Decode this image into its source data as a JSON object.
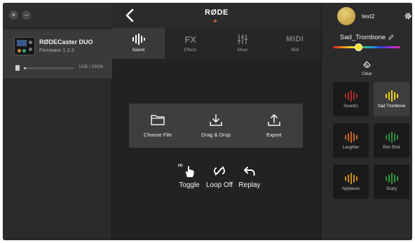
{
  "window": {
    "close_glyph": "×",
    "minimize_glyph": "–"
  },
  "device": {
    "name": "RØDECaster DUO",
    "firmware": "Firmware 1.2.2",
    "storage_text": "1GB / 29GB",
    "storage_used_fraction": 0.035
  },
  "header": {
    "logo": "RØDE"
  },
  "tabs": [
    {
      "label": "Sound",
      "icon": "sound-wave-icon",
      "active": true
    },
    {
      "label": "Effects",
      "icon_text": "FX",
      "icon": "fx-icon",
      "active": false
    },
    {
      "label": "Mixer",
      "icon": "mixer-faders-icon",
      "active": false
    },
    {
      "label": "Midi",
      "icon_text": "MIDI",
      "icon": "midi-icon",
      "active": false
    }
  ],
  "file_actions": [
    {
      "label": "Choose File",
      "icon": "folder-icon"
    },
    {
      "label": "Drag & Drop",
      "icon": "download-icon"
    },
    {
      "label": "Export",
      "icon": "export-icon"
    }
  ],
  "playback": [
    {
      "label": "Toggle",
      "icon": "toggle-hand-icon",
      "badge": "I/O"
    },
    {
      "label": "Loop Off",
      "icon": "loop-off-icon"
    },
    {
      "label": "Replay",
      "icon": "replay-icon"
    }
  ],
  "user": {
    "name": "test2"
  },
  "sound": {
    "title": "Sad_Trombone",
    "color_position": 0.38,
    "clear_label": "Clear"
  },
  "pads": [
    {
      "label": "Sound1",
      "color": "#b02a2a",
      "active": false
    },
    {
      "label": "Sad Trombone",
      "color": "#f2d21e",
      "active": true
    },
    {
      "label": "Laughter",
      "color": "#c9641f",
      "active": false
    },
    {
      "label": "Rim Shot",
      "color": "#2f8f3a",
      "active": false
    },
    {
      "label": "Applause",
      "color": "#c98a1f",
      "active": false
    },
    {
      "label": "Scary",
      "color": "#2f9a3a",
      "active": false
    }
  ],
  "colors": {
    "accent_yellow": "#f4e029",
    "panel": "#3e3e3e",
    "background": "#222222"
  }
}
